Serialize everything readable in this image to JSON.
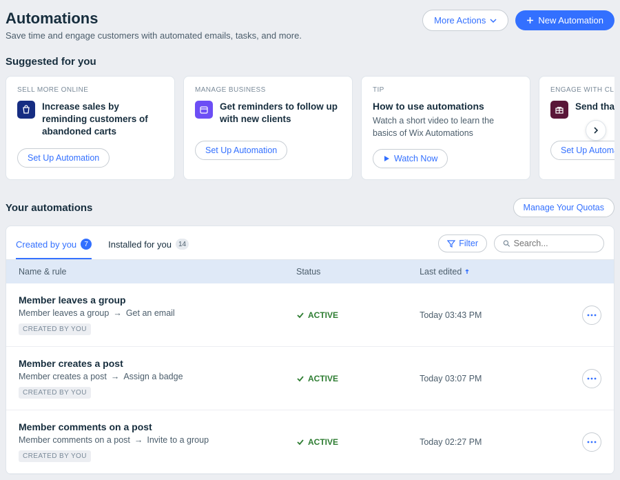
{
  "header": {
    "title": "Automations",
    "subtitle": "Save time and engage customers with automated emails, tasks, and more.",
    "more_actions": "More Actions",
    "new_automation": "New Automation"
  },
  "suggested": {
    "title": "Suggested for you",
    "cards": [
      {
        "category": "SELL MORE ONLINE",
        "title": "Increase sales by reminding customers of abandoned carts",
        "action": "Set Up Automation",
        "icon": "shopping-bag",
        "iconClass": "navy"
      },
      {
        "category": "MANAGE BUSINESS",
        "title": "Get reminders to follow up with new clients",
        "action": "Set Up Automation",
        "icon": "calendar",
        "iconClass": "purple"
      },
      {
        "category": "TIP",
        "title": "How to use automations",
        "desc": "Watch a short video to learn the basics of Wix Automations",
        "action": "Watch Now",
        "isTip": true
      },
      {
        "category": "ENGAGE WITH CLIENTS",
        "title": "Send thank who su",
        "action": "Set Up Automation",
        "icon": "gift",
        "iconClass": "dark"
      }
    ]
  },
  "yourAutomations": {
    "title": "Your automations",
    "manageQuotas": "Manage Your Quotas",
    "tabs": [
      {
        "label": "Created by you",
        "count": "7",
        "active": true
      },
      {
        "label": "Installed for you",
        "count": "14",
        "active": false
      }
    ],
    "filter": "Filter",
    "searchPlaceholder": "Search...",
    "columns": {
      "name": "Name & rule",
      "status": "Status",
      "edited": "Last edited"
    },
    "rows": [
      {
        "title": "Member leaves a group",
        "trigger": "Member leaves a group",
        "action": "Get an email",
        "tag": "CREATED BY YOU",
        "status": "ACTIVE",
        "edited": "Today 03:43 PM"
      },
      {
        "title": "Member creates a post",
        "trigger": "Member creates a post",
        "action": "Assign a badge",
        "tag": "CREATED BY YOU",
        "status": "ACTIVE",
        "edited": "Today 03:07 PM"
      },
      {
        "title": "Member comments on a post",
        "trigger": "Member comments on a post",
        "action": "Invite to a group",
        "tag": "CREATED BY YOU",
        "status": "ACTIVE",
        "edited": "Today 02:27 PM"
      }
    ]
  }
}
